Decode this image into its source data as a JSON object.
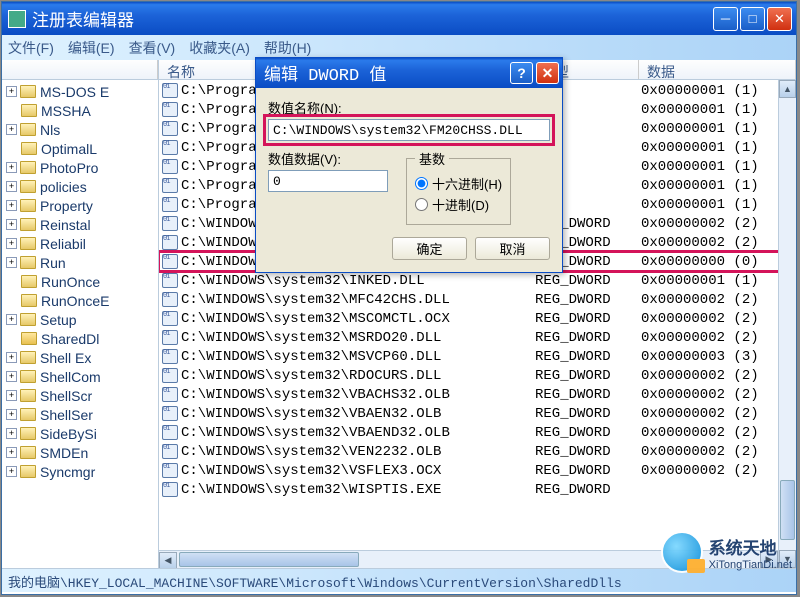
{
  "window": {
    "title": "注册表编辑器"
  },
  "menu": {
    "file": "文件(F)",
    "edit": "编辑(E)",
    "view": "查看(V)",
    "favorites": "收藏夹(A)",
    "help": "帮助(H)"
  },
  "columns": {
    "name": "名称",
    "type": "类型",
    "data": "数据"
  },
  "tree": [
    {
      "exp": "+",
      "label": "MS-DOS E"
    },
    {
      "exp": "",
      "label": "MSSHA"
    },
    {
      "exp": "+",
      "label": "Nls"
    },
    {
      "exp": "",
      "label": "OptimalL"
    },
    {
      "exp": "+",
      "label": "PhotoPro"
    },
    {
      "exp": "+",
      "label": "policies"
    },
    {
      "exp": "+",
      "label": "Property"
    },
    {
      "exp": "+",
      "label": "Reinstal"
    },
    {
      "exp": "+",
      "label": "Reliabil"
    },
    {
      "exp": "+",
      "label": "Run"
    },
    {
      "exp": "",
      "label": "RunOnce"
    },
    {
      "exp": "",
      "label": "RunOnceE"
    },
    {
      "exp": "+",
      "label": "Setup"
    },
    {
      "exp": "",
      "label": "SharedDl",
      "open": true
    },
    {
      "exp": "+",
      "label": "Shell Ex"
    },
    {
      "exp": "+",
      "label": "ShellCom"
    },
    {
      "exp": "+",
      "label": "ShellScr"
    },
    {
      "exp": "+",
      "label": "ShellSer"
    },
    {
      "exp": "+",
      "label": "SideBySi"
    },
    {
      "exp": "+",
      "label": "SMDEn"
    },
    {
      "exp": "+",
      "label": "Syncmgr"
    }
  ],
  "rows": [
    {
      "name": "C:\\Progra",
      "type": "ORD",
      "data": "0x00000001 (1)"
    },
    {
      "name": "C:\\Progra",
      "type": "ORD",
      "data": "0x00000001 (1)"
    },
    {
      "name": "C:\\Progra",
      "type": "ORD",
      "data": "0x00000001 (1)"
    },
    {
      "name": "C:\\Progra",
      "type": "ORD",
      "data": "0x00000001 (1)"
    },
    {
      "name": "C:\\Progra",
      "type": "ORD",
      "data": "0x00000001 (1)"
    },
    {
      "name": "C:\\Progra",
      "type": "ORD",
      "data": "0x00000001 (1)"
    },
    {
      "name": "C:\\Progra",
      "type": "ORD",
      "data": "0x00000001 (1)"
    },
    {
      "name": "C:\\WINDOWS\\system32\\",
      "type": "REG_DWORD",
      "data": "0x00000002 (2)"
    },
    {
      "name": "C:\\WINDOWS\\system32\\FM20CHS.DLL",
      "type": "REG_DWORD",
      "data": "0x00000002 (2)"
    },
    {
      "name": "C:\\WINDOWS\\system32\\FM20CHSS.DLL",
      "type": "REG_DWORD",
      "data": "0x00000000 (0)",
      "hl": true
    },
    {
      "name": "C:\\WINDOWS\\system32\\INKED.DLL",
      "type": "REG_DWORD",
      "data": "0x00000001 (1)"
    },
    {
      "name": "C:\\WINDOWS\\system32\\MFC42CHS.DLL",
      "type": "REG_DWORD",
      "data": "0x00000002 (2)"
    },
    {
      "name": "C:\\WINDOWS\\system32\\MSCOMCTL.OCX",
      "type": "REG_DWORD",
      "data": "0x00000002 (2)"
    },
    {
      "name": "C:\\WINDOWS\\system32\\MSRDO20.DLL",
      "type": "REG_DWORD",
      "data": "0x00000002 (2)"
    },
    {
      "name": "C:\\WINDOWS\\system32\\MSVCP60.DLL",
      "type": "REG_DWORD",
      "data": "0x00000003 (3)"
    },
    {
      "name": "C:\\WINDOWS\\system32\\RDOCURS.DLL",
      "type": "REG_DWORD",
      "data": "0x00000002 (2)"
    },
    {
      "name": "C:\\WINDOWS\\system32\\VBACHS32.OLB",
      "type": "REG_DWORD",
      "data": "0x00000002 (2)"
    },
    {
      "name": "C:\\WINDOWS\\system32\\VBAEN32.OLB",
      "type": "REG_DWORD",
      "data": "0x00000002 (2)"
    },
    {
      "name": "C:\\WINDOWS\\system32\\VBAEND32.OLB",
      "type": "REG_DWORD",
      "data": "0x00000002 (2)"
    },
    {
      "name": "C:\\WINDOWS\\system32\\VEN2232.OLB",
      "type": "REG_DWORD",
      "data": "0x00000002 (2)"
    },
    {
      "name": "C:\\WINDOWS\\system32\\VSFLEX3.OCX",
      "type": "REG_DWORD",
      "data": "0x00000002 (2)"
    },
    {
      "name": "C:\\WINDOWS\\system32\\WISPTIS.EXE",
      "type": "REG_DWORD",
      "data": ""
    }
  ],
  "statusbar": "我的电脑\\HKEY_LOCAL_MACHINE\\SOFTWARE\\Microsoft\\Windows\\CurrentVersion\\SharedDlls",
  "dialog": {
    "title": "编辑 DWORD 值",
    "name_label": "数值名称(N):",
    "name_value": "C:\\WINDOWS\\system32\\FM20CHSS.DLL",
    "data_label": "数值数据(V):",
    "data_value": "0",
    "base_legend": "基数",
    "hex": "十六进制(H)",
    "dec": "十进制(D)",
    "ok": "确定",
    "cancel": "取消"
  },
  "watermark": {
    "line1": "系统天地",
    "line2": "XiTongTianDi.net"
  }
}
